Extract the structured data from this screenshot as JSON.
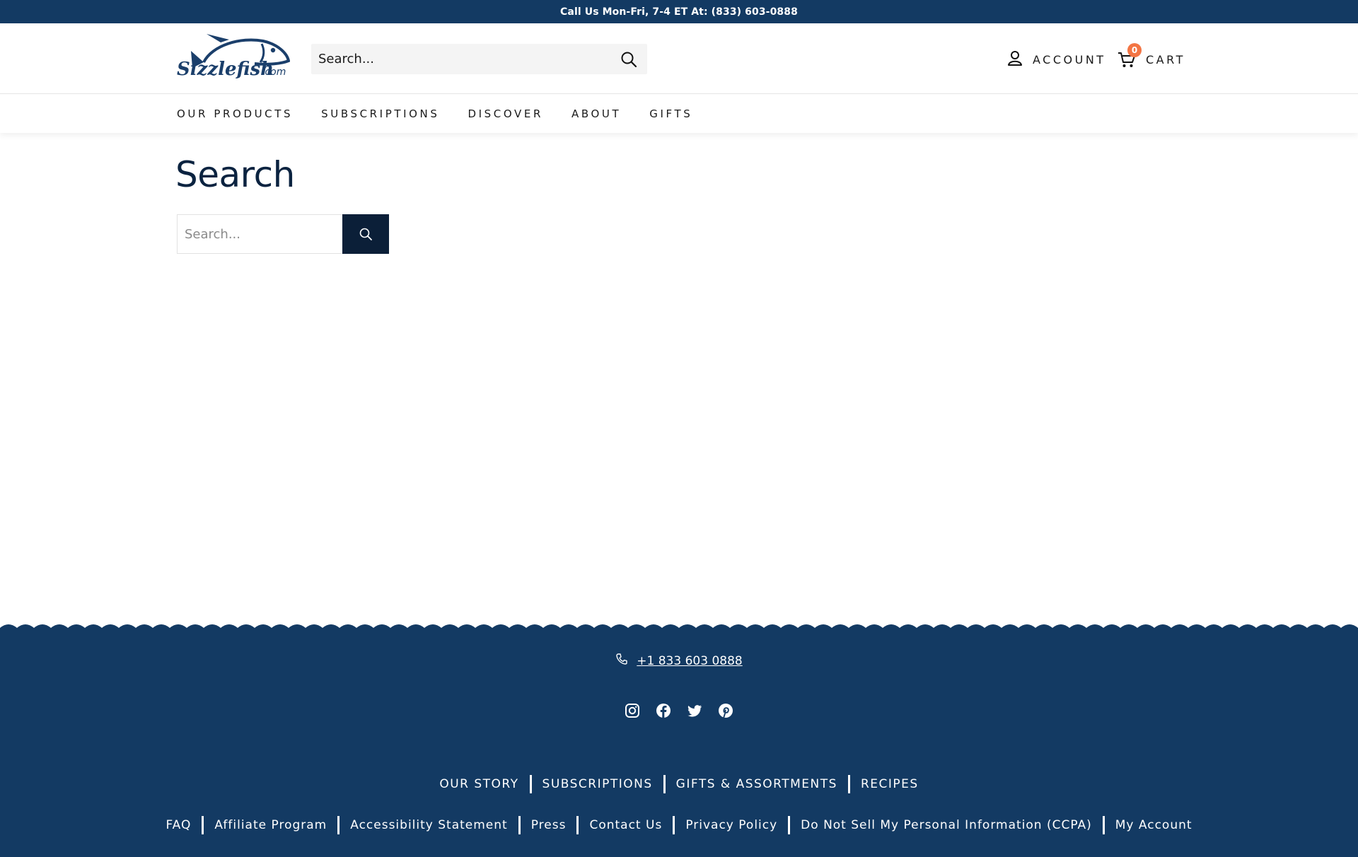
{
  "announcement": {
    "text": "Call Us Mon-Fri, 7-4 ET At: (833) 603-0888"
  },
  "header": {
    "logo_text": "Sizzlefish.com",
    "search": {
      "placeholder": "Search..."
    },
    "account_label": "ACCOUNT",
    "cart_label": "CART",
    "cart_count": "0",
    "accent_color": "#f37544"
  },
  "nav": {
    "items": [
      "OUR PRODUCTS",
      "SUBSCRIPTIONS",
      "DISCOVER",
      "ABOUT",
      "GIFTS"
    ]
  },
  "main": {
    "title": "Search",
    "search": {
      "placeholder": "Search..."
    }
  },
  "footer": {
    "background": "#133a63",
    "phone": "+1 833 603 0888",
    "social": [
      "instagram-icon",
      "facebook-icon",
      "twitter-icon",
      "pinterest-icon"
    ],
    "primary_links": [
      "OUR STORY",
      "SUBSCRIPTIONS",
      "GIFTS & ASSORTMENTS",
      "RECIPES"
    ],
    "secondary_links": [
      "FAQ",
      "Affiliate Program",
      "Accessibility Statement",
      "Press",
      "Contact Us",
      "Privacy Policy",
      "Do Not Sell My Personal Information (CCPA)",
      "My Account"
    ]
  }
}
